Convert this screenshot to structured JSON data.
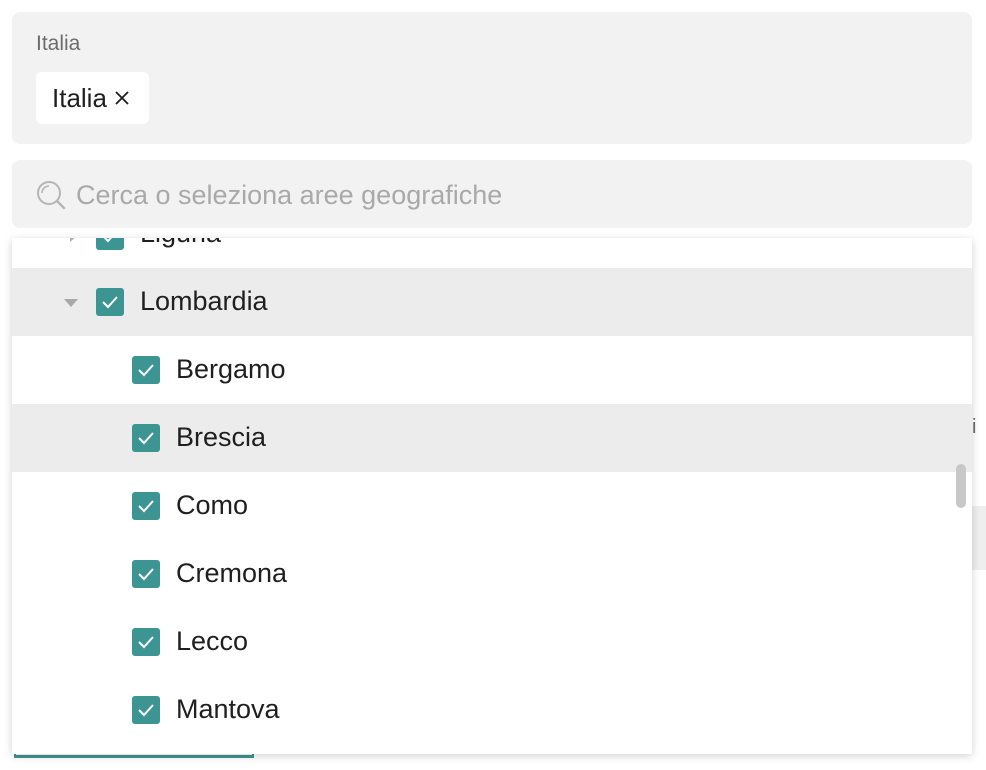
{
  "selected_panel": {
    "title": "Italia",
    "chips": [
      {
        "label": "Italia",
        "remove_icon": "close-icon"
      }
    ]
  },
  "search": {
    "placeholder": "Cerca o seleziona aree geografiche",
    "value": "",
    "icon": "search-icon"
  },
  "background_fragment": {
    "text": "i"
  },
  "tree": {
    "items": [
      {
        "label": "Liguria",
        "level": 1,
        "checked": true,
        "expanded": false,
        "highlighted": false
      },
      {
        "label": "Lombardia",
        "level": 1,
        "checked": true,
        "expanded": true,
        "highlighted": true
      },
      {
        "label": "Bergamo",
        "level": 2,
        "checked": true,
        "highlighted": false
      },
      {
        "label": "Brescia",
        "level": 2,
        "checked": true,
        "highlighted": true
      },
      {
        "label": "Como",
        "level": 2,
        "checked": true,
        "highlighted": false
      },
      {
        "label": "Cremona",
        "level": 2,
        "checked": true,
        "highlighted": false
      },
      {
        "label": "Lecco",
        "level": 2,
        "checked": true,
        "highlighted": false
      },
      {
        "label": "Mantova",
        "level": 2,
        "checked": true,
        "highlighted": false
      }
    ]
  },
  "colors": {
    "checkbox": "#3d9593",
    "highlight_row": "#ececec",
    "panel_bg": "#f1f2f1"
  }
}
